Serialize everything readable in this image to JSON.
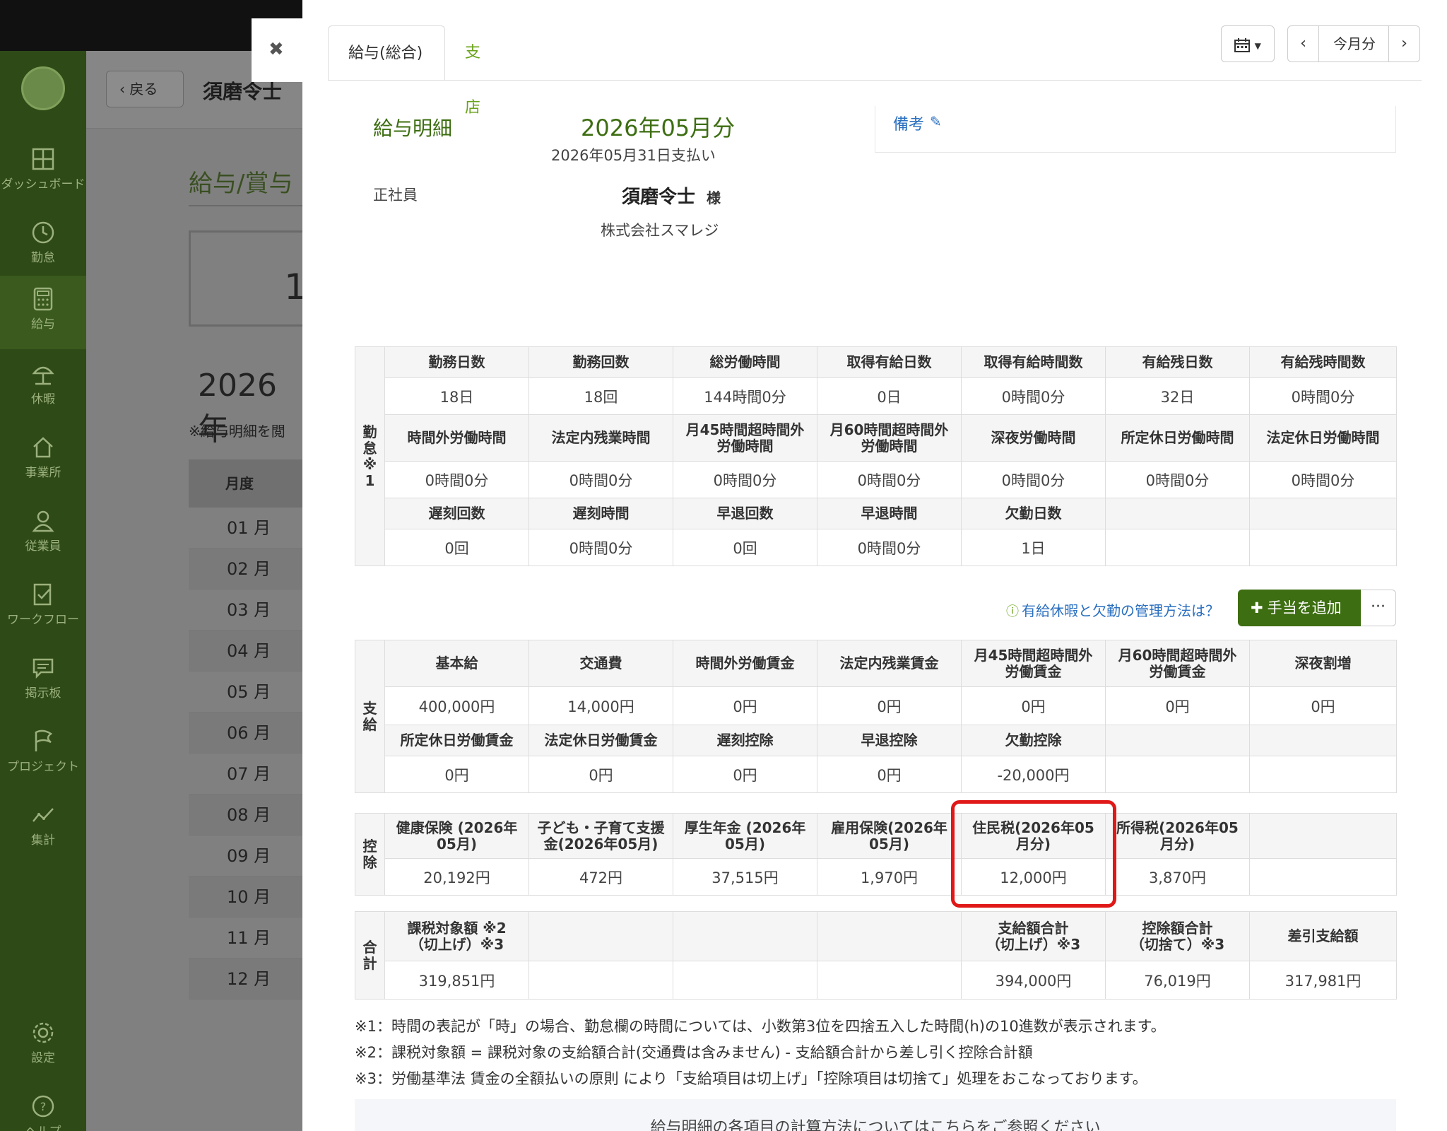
{
  "sidebar": {
    "items": [
      {
        "label": "ダッシュボード",
        "icon": "dashboard-icon"
      },
      {
        "label": "勤怠",
        "icon": "clock-icon"
      },
      {
        "label": "給与",
        "icon": "calculator-icon"
      },
      {
        "label": "休暇",
        "icon": "umbrella-icon"
      },
      {
        "label": "事業所",
        "icon": "home-icon"
      },
      {
        "label": "従業員",
        "icon": "user-icon"
      },
      {
        "label": "ワークフロー",
        "icon": "workflow-icon"
      },
      {
        "label": "掲示板",
        "icon": "message-icon"
      },
      {
        "label": "プロジェクト",
        "icon": "flag-icon"
      },
      {
        "label": "集計",
        "icon": "chart-icon"
      },
      {
        "label": "設定",
        "icon": "gear-icon"
      },
      {
        "label": "ヘルプ",
        "icon": "help-icon"
      }
    ]
  },
  "behind": {
    "back_label": "戻る",
    "employee_name": "須磨令士",
    "title": "給与/賞与",
    "box_value": "1",
    "year": "2026年",
    "note": "※給与明細を閲",
    "month_header": "月度",
    "months": [
      "01 月",
      "02 月",
      "03 月",
      "04 月",
      "05 月",
      "06 月",
      "07 月",
      "08 月",
      "09 月",
      "10 月",
      "11 月",
      "12 月"
    ]
  },
  "panel": {
    "close_icon": "✖",
    "tabs": [
      "給与(総合)",
      "支店"
    ],
    "calendar_icon": "calendar-icon",
    "nav_prev": "‹",
    "nav_current": "今月分",
    "nav_next": "›"
  },
  "payslip": {
    "title": "給与明細",
    "month": "2026年05月分",
    "pay_date": "2026年05月31日支払い",
    "employee_type": "正社員",
    "employee_name": "須磨令士",
    "honorific": "様",
    "company": "株式会社スマレジ",
    "remarks_label": "備考"
  },
  "attendance": {
    "side_label": "勤\n怠\n※\n1",
    "rows": [
      {
        "headers": [
          "勤務日数",
          "勤務回数",
          "総労働時間",
          "取得有給日数",
          "取得有給時間数",
          "有給残日数",
          "有給残時間数"
        ],
        "values": [
          "18日",
          "18回",
          "144時間0分",
          "0日",
          "0時間0分",
          "32日",
          "0時間0分"
        ]
      },
      {
        "headers": [
          "時間外労働時間",
          "法定内残業時間",
          "月45時間超時間外\n労働時間",
          "月60時間超時間外\n労働時間",
          "深夜労働時間",
          "所定休日労働時間",
          "法定休日労働時間"
        ],
        "values": [
          "0時間0分",
          "0時間0分",
          "0時間0分",
          "0時間0分",
          "0時間0分",
          "0時間0分",
          "0時間0分"
        ]
      },
      {
        "headers": [
          "遅刻回数",
          "遅刻時間",
          "早退回数",
          "早退時間",
          "欠勤日数",
          "",
          ""
        ],
        "values": [
          "0回",
          "0時間0分",
          "0回",
          "0時間0分",
          "1日",
          "",
          ""
        ]
      }
    ]
  },
  "actions": {
    "help_link": "有給休暇と欠勤の管理方法は？",
    "add_allowance": "手当を追加",
    "more": "···"
  },
  "payments": {
    "side_label": "支\n給",
    "rows": [
      {
        "headers": [
          "基本給",
          "交通費",
          "時間外労働賃金",
          "法定内残業賃金",
          "月45時間超時間外\n労働賃金",
          "月60時間超時間外\n労働賃金",
          "深夜割増"
        ],
        "values": [
          "400,000円",
          "14,000円",
          "0円",
          "0円",
          "0円",
          "0円",
          "0円"
        ]
      },
      {
        "headers": [
          "所定休日労働賃金",
          "法定休日労働賃金",
          "遅刻控除",
          "早退控除",
          "欠勤控除",
          "",
          ""
        ],
        "values": [
          "0円",
          "0円",
          "0円",
          "0円",
          "-20,000円",
          "",
          ""
        ]
      }
    ]
  },
  "deductions": {
    "side_label": "控\n除",
    "headers": [
      "健康保険 (2026年\n05月)",
      "子ども・子育て支援\n金(2026年05月)",
      "厚生年金 (2026年\n05月)",
      "雇用保険(2026年\n05月)",
      "住民税(2026年05\n月分)",
      "所得税(2026年05\n月分)",
      ""
    ],
    "values": [
      "20,192円",
      "472円",
      "37,515円",
      "1,970円",
      "12,000円",
      "3,870円",
      ""
    ]
  },
  "totals": {
    "side_label": "合\n計",
    "headers": [
      "課税対象額 ※2\n（切上げ）※3",
      "",
      "",
      "",
      "支給額合計\n（切上げ）※3",
      "控除額合計\n（切捨て）※3",
      "差引支給額"
    ],
    "values": [
      "319,851円",
      "",
      "",
      "",
      "394,000円",
      "76,019円",
      "317,981円"
    ]
  },
  "notes": [
    "※1：時間の表記が「時」の場合、勤怠欄の時間については、小数第3位を四捨五入した時間(h)の10進数が表示されます。",
    "※2：課税対象額 = 課税対象の支給額合計(交通費は含みません) - 支給額合計から差し引く控除合計額",
    "※3：労働基準法 賃金の全額払いの原則 により「支給項目は切上げ」「控除項目は切捨て」処理をおこなっております。"
  ],
  "calc_link": "給与明細の各項目の計算方法についてはこちらをご参照ください"
}
